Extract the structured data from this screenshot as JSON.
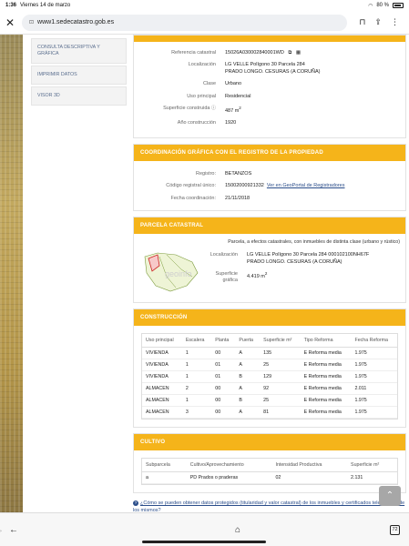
{
  "status": {
    "time": "1:36",
    "date": "Viernes 14 de marzo",
    "battery": "80 %"
  },
  "browser": {
    "url": "www1.sedecatastro.gob.es",
    "close_glyph": "✕",
    "tabs_count": "72"
  },
  "sidebar": {
    "items": [
      {
        "label": "CONSULTA DESCRIPTIVA Y GRÁFICA"
      },
      {
        "label": "IMPRIMIR DATOS"
      },
      {
        "label": "VISOR 3D"
      }
    ]
  },
  "inmueble": {
    "referencia_label": "Referencia catastral",
    "referencia": "15026A030002840001WD",
    "localizacion_label": "Localización",
    "localizacion_1": "LG VELLE Polígono 30 Parcela 284",
    "localizacion_2": "PRADO LONGO. CESURAS (A CORUÑA)",
    "clase_label": "Clase",
    "clase": "Urbano",
    "uso_label": "Uso principal",
    "uso": "Residencial",
    "superficie_label": "Superficie construida",
    "superficie": "487 m",
    "superficie_sup": "2",
    "anio_label": "Año construcción",
    "anio": "1920"
  },
  "coordinacion": {
    "title": "COORDINACIÓN GRÁFICA CON EL REGISTRO DE LA PROPIEDAD",
    "registro_label": "Registro:",
    "registro": "BETANZOS",
    "codigo_label": "Código registral único:",
    "codigo": "15002000921332",
    "codigo_link": "Ver en GeoPortal de Registradores",
    "fecha_label": "Fecha coordinación:",
    "fecha": "21/11/2018"
  },
  "parcela": {
    "title": "PARCELA CATASTRAL",
    "description": "Parcela, a efectos catastrales, con inmuebles de distinta clase (urbano y rústico)",
    "localizacion_label": "Localización",
    "localizacion_1": "LG VELLE Polígono 30 Parcela 284 000102100NH67F",
    "localizacion_2": "PRADO LONGO. CESURAS (A CORUÑA)",
    "superficie_label_1": "Superficie",
    "superficie_label_2": "gráfica",
    "superficie": "4.419 m",
    "superficie_sup": "2",
    "watermark": "geoinfo"
  },
  "construccion": {
    "title": "CONSTRUCCIÓN",
    "headers": [
      "Uso principal",
      "Escalera",
      "Planta",
      "Puerta",
      "Superficie m²",
      "Tipo Reforma",
      "Fecha Reforma"
    ],
    "rows": [
      [
        "VIVIENDA",
        "1",
        "00",
        "A",
        "135",
        "E Reforma media",
        "1.975"
      ],
      [
        "VIVIENDA",
        "1",
        "01",
        "A",
        "25",
        "E Reforma media",
        "1.975"
      ],
      [
        "VIVIENDA",
        "1",
        "01",
        "B",
        "129",
        "E Reforma media",
        "1.975"
      ],
      [
        "ALMACEN",
        "2",
        "00",
        "A",
        "92",
        "E Reforma media",
        "2.011"
      ],
      [
        "ALMACEN",
        "1",
        "00",
        "B",
        "25",
        "E Reforma media",
        "1.975"
      ],
      [
        "ALMACEN",
        "3",
        "00",
        "A",
        "81",
        "E Reforma media",
        "1.975"
      ]
    ]
  },
  "cultivo": {
    "title": "CULTIVO",
    "headers": [
      "Subparcela",
      "Cultivo/Aprovechamiento",
      "Intensidad Productiva",
      "Superficie m²"
    ],
    "rows": [
      [
        "a",
        "PD Prados o praderas",
        "02",
        "2.131"
      ]
    ]
  },
  "footer": {
    "help_link": "¿Cómo se pueden obtener datos protegidos (titularidad y valor catastral) de los inmuebles y certificados telemáticos de los mismos?"
  },
  "colors": {
    "accent": "#f5b41a",
    "link": "#2a4d8a"
  },
  "icons": [
    "lock-icon",
    "bookmark-icon",
    "share-icon",
    "copy-icon",
    "map-icon",
    "info-icon",
    "arrow-up-icon",
    "back-icon",
    "forward-icon",
    "home-icon",
    "tabs-icon"
  ]
}
